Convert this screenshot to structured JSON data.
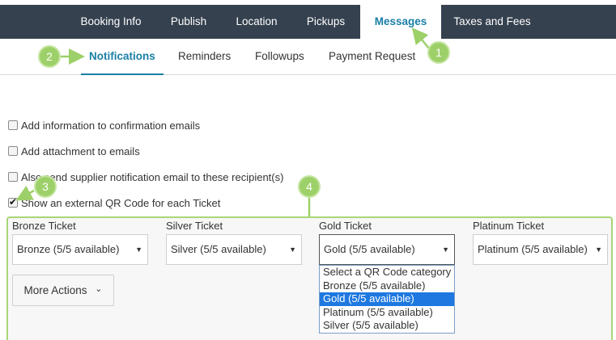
{
  "top_tabs": [
    {
      "label": "Booking Info"
    },
    {
      "label": "Publish"
    },
    {
      "label": "Location"
    },
    {
      "label": "Pickups"
    },
    {
      "label": "Messages",
      "active": true
    },
    {
      "label": "Taxes and Fees"
    }
  ],
  "sub_tabs": [
    {
      "label": "Notifications",
      "active": true
    },
    {
      "label": "Reminders"
    },
    {
      "label": "Followups"
    },
    {
      "label": "Payment Request"
    }
  ],
  "options": {
    "add_info_confirmation": {
      "label": "Add information to confirmation emails",
      "checked": false
    },
    "add_attachment": {
      "label": "Add attachment to emails",
      "checked": false
    },
    "supplier_notification": {
      "label": "Also send supplier notification email to these recipient(s)",
      "checked": false
    },
    "external_qr": {
      "label": "Show an external QR Code for each Ticket",
      "checked": true
    }
  },
  "tickets": [
    {
      "label": "Bronze Ticket",
      "selected": "Bronze (5/5 available)"
    },
    {
      "label": "Silver Ticket",
      "selected": "Silver (5/5 available)"
    },
    {
      "label": "Gold Ticket",
      "selected": "Gold (5/5 available)"
    },
    {
      "label": "Platinum Ticket",
      "selected": "Platinum (5/5 available)"
    }
  ],
  "gold_dropdown_options": [
    "Select a QR Code category",
    "Bronze (5/5 available)",
    "Gold (5/5 available)",
    "Platinum (5/5 available)",
    "Silver (5/5 available)"
  ],
  "gold_dropdown_highlighted": "Gold (5/5 available)",
  "more_actions": {
    "label": "More Actions",
    "chevron": "⌄"
  },
  "dropdown_arrow": "▼",
  "callouts": [
    "1",
    "2",
    "3",
    "4"
  ],
  "colors": {
    "topbar": "#35414f",
    "accent": "#1a7fa5",
    "callout_green": "#9dd069",
    "panel_border": "#a9d676",
    "option_highlight": "#1e78e0"
  }
}
